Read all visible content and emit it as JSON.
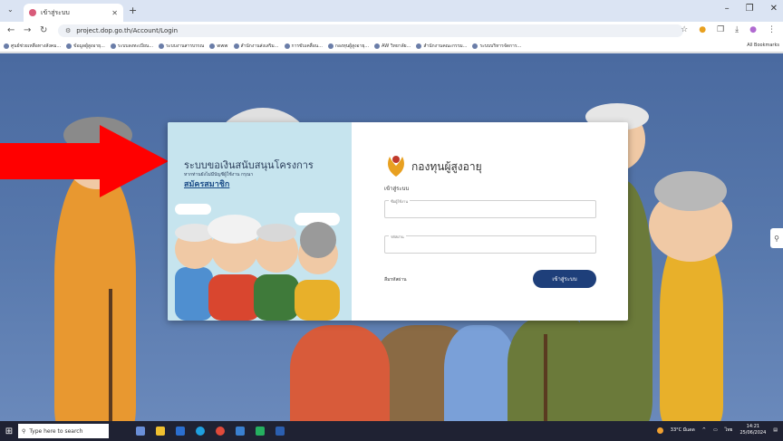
{
  "browser": {
    "tab_title": "เข้าสู่ระบบ",
    "url": "project.dop.go.th/Account/Login",
    "all_bookmarks": "All Bookmarks",
    "bookmarks": [
      "ศูนย์ช่วยเหลือทางสังคม...",
      "ข้อมูลผู้สูงอายุ...",
      "ระบบลงทะเบียน...",
      "ระบบงานสารบรรณ",
      "www",
      "สำนักงานส่งเสริม...",
      "การขับเคลื่อน...",
      "กองทุนผู้สูงอายุ...",
      "AW วิทยาลัย...",
      "สำนักงานคณะกรรม...",
      "ระบบบริหารจัดการ..."
    ]
  },
  "login_card": {
    "left": {
      "title": "ระบบขอเงินสนับสนุนโครงการ",
      "subtitle": "หากท่านยังไม่มีบัญชีผู้ใช้งาน กรุณา",
      "register_link": "สมัครสมาชิก"
    },
    "right": {
      "brand": "กองทุนผู้สูงอายุ",
      "heading": "เข้าสู่ระบบ",
      "username_label": "ชื่อผู้ใช้งาน",
      "password_label": "รหัสผ่าน",
      "forgot_password": "ลืมรหัสผ่าน",
      "login_button": "เข้าสู่ระบบ"
    }
  },
  "taskbar": {
    "search_placeholder": "Type here to search",
    "weather": "33°C มีแดด",
    "language": "ไทย",
    "time": "14:21",
    "date": "25/06/2024"
  },
  "colors": {
    "accent": "#1e3f7a",
    "arrow": "#ff0000",
    "card_left_bg": "#c6e4ee"
  }
}
